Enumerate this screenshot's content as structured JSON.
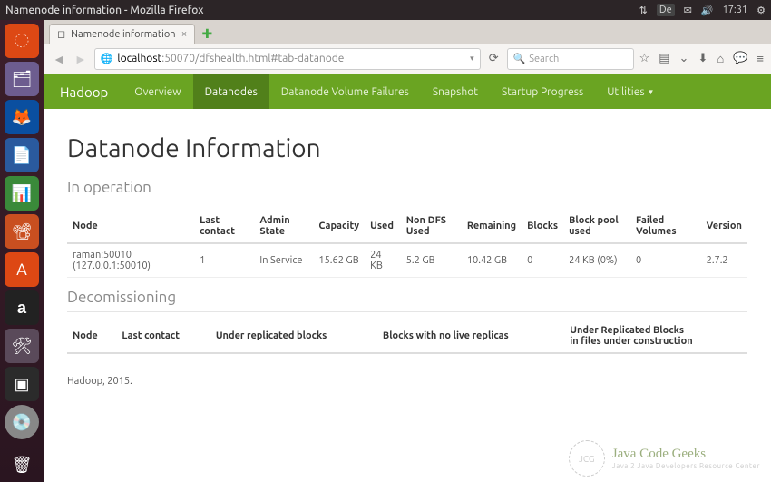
{
  "os": {
    "window_title": "Namenode information - Mozilla Firefox",
    "lang": "De",
    "time": "17:31"
  },
  "browser": {
    "tab_title": "Namenode information",
    "url_host": "localhost",
    "url_path": ":50070/dfshealth.html#tab-datanode",
    "search_placeholder": "Search"
  },
  "nav": {
    "brand": "Hadoop",
    "items": [
      "Overview",
      "Datanodes",
      "Datanode Volume Failures",
      "Snapshot",
      "Startup Progress",
      "Utilities"
    ],
    "active_index": 1
  },
  "page": {
    "heading": "Datanode Information",
    "section1": "In operation",
    "section2": "Decomissioning",
    "footer": "Hadoop, 2015."
  },
  "table1": {
    "headers": [
      "Node",
      "Last contact",
      "Admin State",
      "Capacity",
      "Used",
      "Non DFS Used",
      "Remaining",
      "Blocks",
      "Block pool used",
      "Failed Volumes",
      "Version"
    ],
    "rows": [
      [
        "raman:50010 (127.0.0.1:50010)",
        "1",
        "In Service",
        "15.62 GB",
        "24 KB",
        "5.2 GB",
        "10.42 GB",
        "0",
        "24 KB (0%)",
        "0",
        "2.7.2"
      ]
    ]
  },
  "table2": {
    "headers": [
      "Node",
      "Last contact",
      "Under replicated blocks",
      "Blocks with no live replicas",
      "Under Replicated Blocks\nin files under construction"
    ]
  },
  "watermark": {
    "badge": "JCG",
    "line1": "Java Code Geeks",
    "line2": "Java 2 Java Developers Resource Center"
  }
}
